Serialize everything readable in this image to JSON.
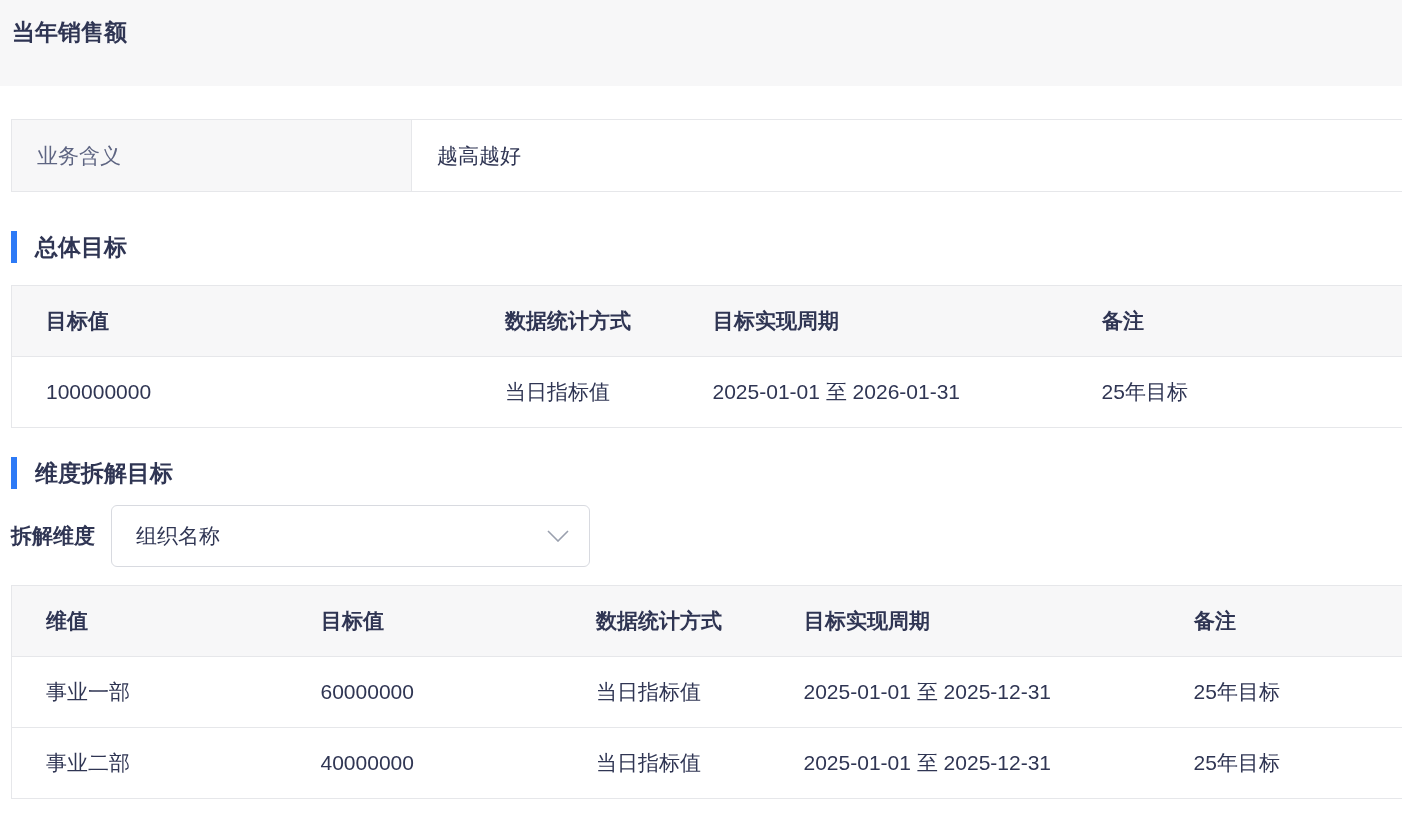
{
  "page_title": "当年销售额",
  "info": {
    "label": "业务含义",
    "value": "越高越好"
  },
  "overall": {
    "heading": "总体目标",
    "columns": [
      "目标值",
      "数据统计方式",
      "目标实现周期",
      "备注"
    ],
    "rows": [
      [
        "100000000",
        "当日指标值",
        "2025-01-01 至 2026-01-31",
        "25年目标"
      ]
    ]
  },
  "breakdown": {
    "heading": "维度拆解目标",
    "select_label": "拆解维度",
    "select_value": "组织名称",
    "columns": [
      "维值",
      "目标值",
      "数据统计方式",
      "目标实现周期",
      "备注"
    ],
    "rows": [
      [
        "事业一部",
        "60000000",
        "当日指标值",
        "2025-01-01 至 2025-12-31",
        "25年目标"
      ],
      [
        "事业二部",
        "40000000",
        "当日指标值",
        "2025-01-01 至 2025-12-31",
        "25年目标"
      ]
    ]
  }
}
